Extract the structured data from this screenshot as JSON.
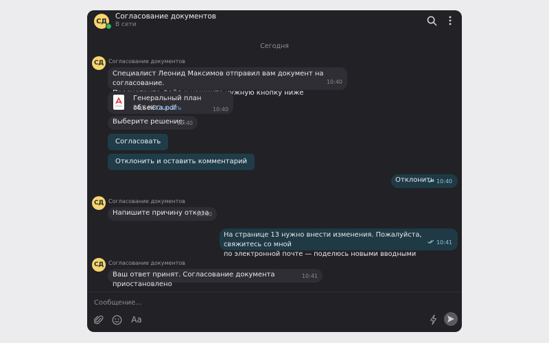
{
  "chat": {
    "avatar_initials": "СД",
    "title": "Согласование документов",
    "status": "В сети"
  },
  "date_separator": "Сегодня",
  "messages": [
    {
      "sender": "Согласование документов",
      "text_line1": "Специалист Леонид Максимов отправил вам документ на согласование.",
      "text_line2": "Просмотрите файл и нажмите нужную кнопку ниже",
      "time": "10:40"
    },
    {
      "file_name": "Генеральный план объекта.pdf",
      "file_size": "74,8 КБ",
      "download_label": "Скачать",
      "time": "10:40"
    },
    {
      "text": "Выберите решение:",
      "time": "10:40"
    }
  ],
  "actions": {
    "approve_label": "Согласовать",
    "reject_label": "Отклонить и оставить комментарий"
  },
  "outgoing1": {
    "text": "Отклонить",
    "time": "10:40"
  },
  "incoming2": {
    "sender": "Согласование документов",
    "text": "Напишите причину отказа",
    "time": "10:40"
  },
  "outgoing2": {
    "text_line1": "На странице 13 нужно внести изменения. Пожалуйста, свяжитесь со мной",
    "text_line2": "по электронной почте — поделюсь новыми вводными",
    "time": "10:41"
  },
  "incoming3": {
    "sender": "Согласование документов",
    "text": "Ваш ответ принят. Согласование документа приостановлено",
    "time": "10:41"
  },
  "composer": {
    "placeholder": "Сообщение...",
    "format_label": "Aa"
  },
  "colors": {
    "accent": "#1f3a45",
    "avatar": "#f7d56f",
    "online": "#2fbf5a"
  }
}
